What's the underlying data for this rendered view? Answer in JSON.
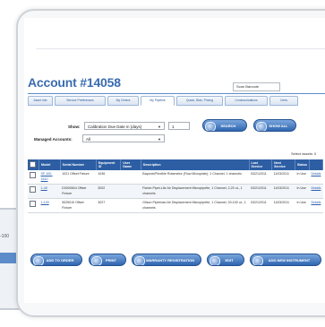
{
  "page": {
    "account_title": "Account #14058",
    "scan_barcode_label": "Scan Barcode",
    "background_fragment": "-100"
  },
  "tabs": [
    {
      "label": "Asset Info"
    },
    {
      "label": "Service Preferences"
    },
    {
      "label": "My Orders"
    },
    {
      "label": "My Pipeline"
    },
    {
      "label": "Quote, Bids, Pricing"
    },
    {
      "label": "Communications"
    },
    {
      "label": "Certs"
    }
  ],
  "filters": {
    "show_label": "Show:",
    "show_value": "Calibration Due Date in (days)",
    "days_value": "1",
    "managed_label": "Managed Accounts:",
    "managed_value": "All",
    "dropdown_arrow": "▼"
  },
  "buttons": {
    "search": "SEARCH",
    "show_all": "SHOW ALL",
    "add_to_order": "ADD TO ORDER",
    "print": "PRINT",
    "warranty_registration": "WARRANTY REGISTRATION",
    "edit": "EDIT",
    "add_new_instrument": "ADD NEW INSTRUMENT"
  },
  "select_count": "Select assets: 0",
  "table": {
    "headers": [
      "Model",
      "Serial Number",
      "Equipment ID",
      "User Name",
      "Description",
      "Last Service",
      "Next Service",
      "Status",
      ""
    ],
    "rows": [
      {
        "model": "SF-100-1610",
        "serial": "1021 Offset Fixture",
        "equipment_id": "1036",
        "user": "",
        "description": "Bayonet/Flexible Rotametor (Flow Microplate), 1 Channel, 1 channels",
        "last_service": "03/21/2011",
        "next_service": "11/03/2011",
        "status": "In Use",
        "action": "Details"
      },
      {
        "model": "1-49",
        "serial": "D0000604 Offset Fixture",
        "equipment_id": "3002",
        "user": "",
        "description": "Rainin Pipet-Lite Air Displacement Micropipette, 1 Channel, 2-20 uL, 1 channels",
        "last_service": "03/21/2011",
        "next_service": "11/03/2011",
        "status": "In Use",
        "action": "Details"
      },
      {
        "model": "1-100",
        "serial": "9025010 Offset Fixture",
        "equipment_id": "3027",
        "user": "",
        "description": "Gilson Pipetman Air Displacement Micropipette, 1 Channel, 20-100 uL, 1 channels",
        "last_service": "03/21/2011",
        "next_service": "11/03/2011",
        "status": "In Use",
        "action": "Details"
      }
    ]
  },
  "colors": {
    "accent": "#3a6cb0",
    "header_bg": "#2d5ea3",
    "button_top": "#7aa6dd",
    "button_bottom": "#2f66b0"
  }
}
